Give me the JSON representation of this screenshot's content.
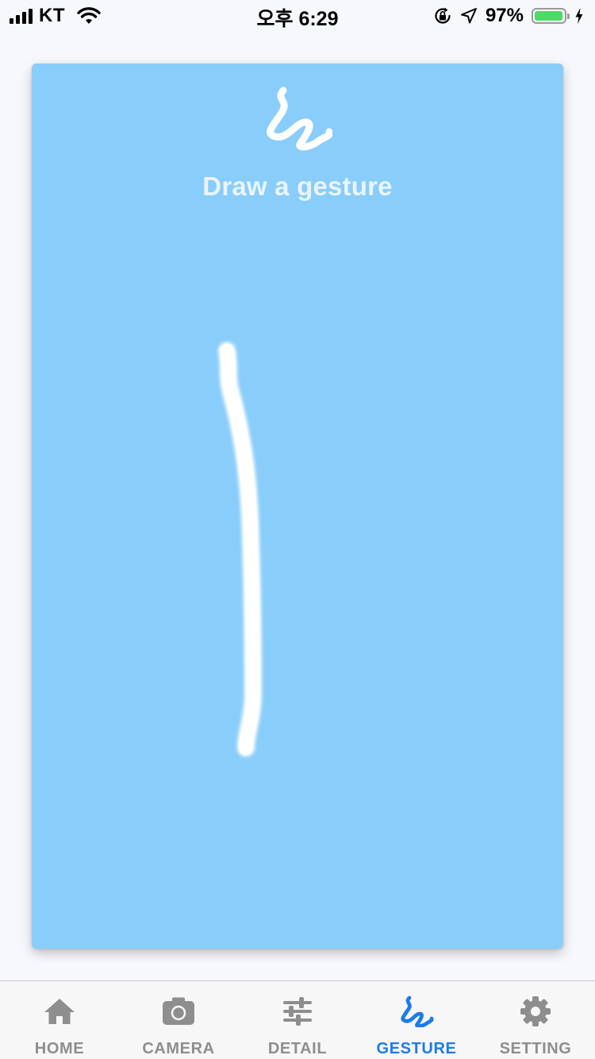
{
  "status_bar": {
    "carrier": "KT",
    "time": "오후 6:29",
    "battery_percent": "97%",
    "battery_level": 0.97,
    "icons": [
      "signal-bars-icon",
      "wifi-icon",
      "orientation-lock-icon",
      "location-arrow-icon",
      "battery-icon",
      "charging-bolt-icon"
    ]
  },
  "card": {
    "icon": "gesture-squiggle-icon",
    "title": "Draw a gesture",
    "background_color": "#89cdfa",
    "stroke_color": "#ffffff"
  },
  "tab_bar": {
    "active_color": "#1e7be8",
    "inactive_color": "#8e8e8e",
    "tabs": [
      {
        "label": "HOME",
        "icon": "home-icon",
        "active": false
      },
      {
        "label": "CAMERA",
        "icon": "camera-icon",
        "active": false
      },
      {
        "label": "DETAIL",
        "icon": "sliders-icon",
        "active": false
      },
      {
        "label": "GESTURE",
        "icon": "gesture-squiggle-icon",
        "active": true
      },
      {
        "label": "SETTING",
        "icon": "gear-icon",
        "active": false
      }
    ]
  }
}
